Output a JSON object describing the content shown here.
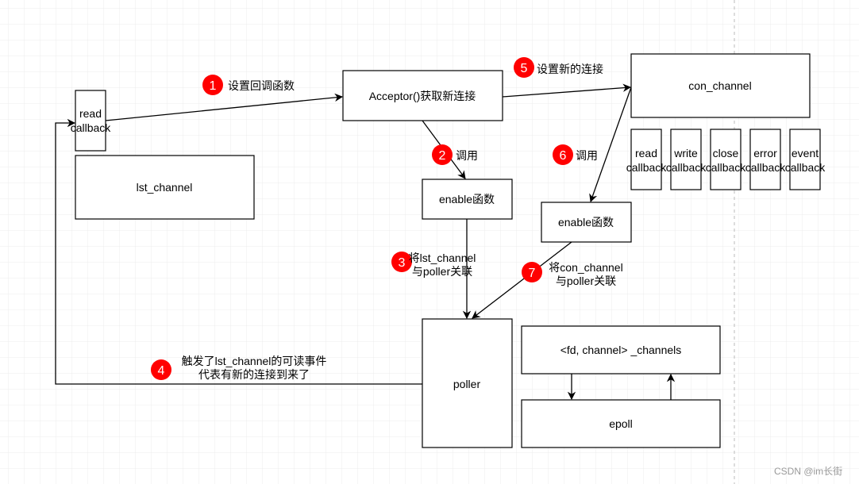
{
  "colors": {
    "badge": "#ff0000",
    "grid": "#ececec"
  },
  "boxes": {
    "read_callback": [
      "read",
      "callback"
    ],
    "lst_channel": "lst_channel",
    "acceptor": "Acceptor()获取新连接",
    "con_channel": "con_channel",
    "enable1": "enable函数",
    "enable2": "enable函数",
    "poller": "poller",
    "channels": "<fd, channel> _channels",
    "epoll": "epoll",
    "callbacks": [
      [
        "read",
        "callback"
      ],
      [
        "write",
        "callback"
      ],
      [
        "close",
        "callback"
      ],
      [
        "error",
        "callback"
      ],
      [
        "event",
        "callback"
      ]
    ]
  },
  "steps": [
    {
      "num": "1",
      "text": [
        "设置回调函数"
      ]
    },
    {
      "num": "2",
      "text": [
        "调用"
      ]
    },
    {
      "num": "3",
      "text": [
        "将lst_channel",
        "与poller关联"
      ]
    },
    {
      "num": "4",
      "text": [
        "触发了lst_channel的可读事件",
        "代表有新的连接到来了"
      ]
    },
    {
      "num": "5",
      "text": [
        "设置新的连接"
      ]
    },
    {
      "num": "6",
      "text": [
        "调用"
      ]
    },
    {
      "num": "7",
      "text": [
        "将con_channel",
        "与poller关联"
      ]
    }
  ],
  "watermark": "CSDN @im长街"
}
